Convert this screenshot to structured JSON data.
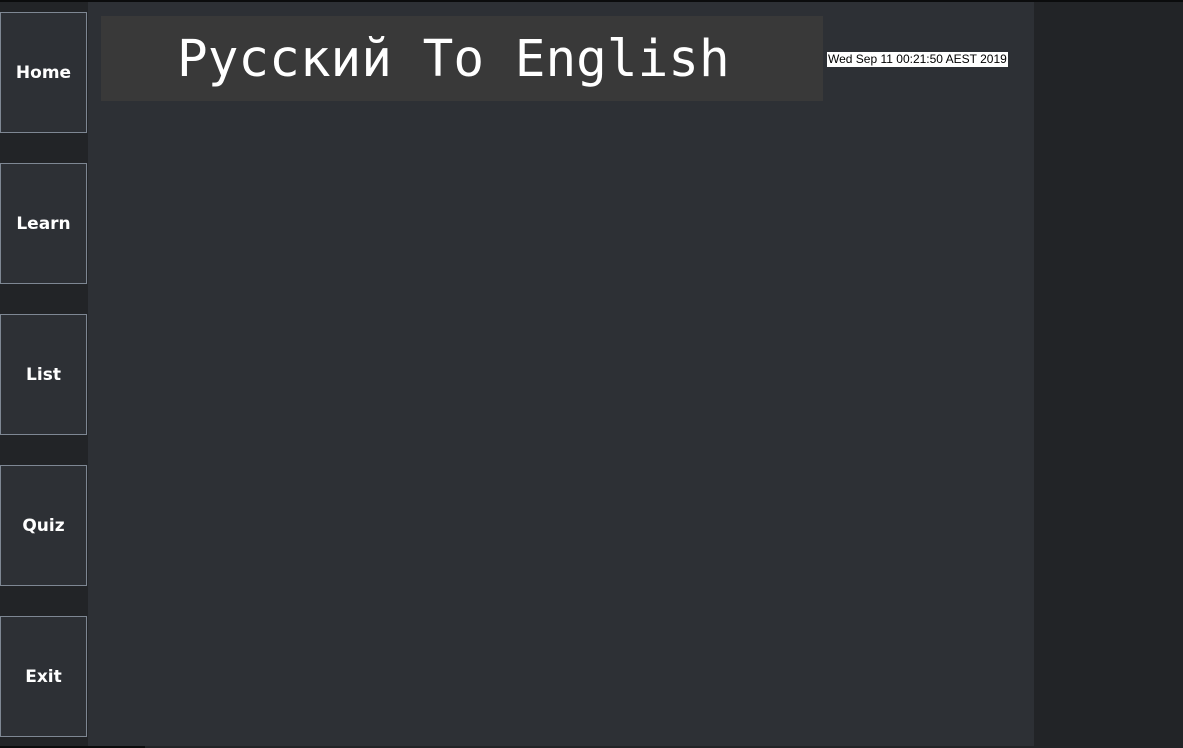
{
  "nav": {
    "home_label": "Home",
    "learn_label": "Learn",
    "list_label": "List",
    "quiz_label": "Quiz",
    "exit_label": "Exit"
  },
  "header": {
    "title": "Русский To English",
    "datetime": "Wed Sep 11 00:21:50 AEST 2019"
  },
  "colors": {
    "background": "#222427",
    "panel": "#2d3035",
    "title_box": "#393939",
    "button_border": "#7e8793",
    "text": "#ffffff"
  }
}
